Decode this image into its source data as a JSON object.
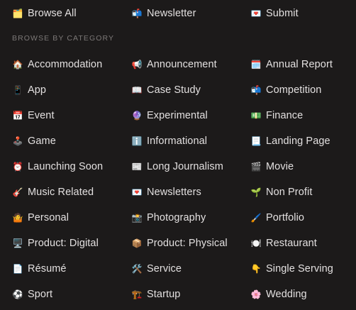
{
  "top": [
    {
      "label": "Browse All",
      "icon": "card-index-dividers-icon",
      "glyph": "🗂️"
    },
    {
      "label": "Newsletter",
      "icon": "mailbox-icon",
      "glyph": "📬"
    },
    {
      "label": "Submit",
      "icon": "love-letter-icon",
      "glyph": "💌"
    }
  ],
  "category_heading": "BROWSE BY CATEGORY",
  "categories": [
    {
      "label": "Accommodation",
      "icon": "house-icon",
      "glyph": "🏠"
    },
    {
      "label": "Announcement",
      "icon": "megaphone-icon",
      "glyph": "📢"
    },
    {
      "label": "Annual Report",
      "icon": "spiral-calendar-icon",
      "glyph": "🗓️"
    },
    {
      "label": "App",
      "icon": "phone-icon",
      "glyph": "📱"
    },
    {
      "label": "Case Study",
      "icon": "open-book-icon",
      "glyph": "📖"
    },
    {
      "label": "Competition",
      "icon": "mailbox-icon",
      "glyph": "📬"
    },
    {
      "label": "Event",
      "icon": "calendar-icon",
      "glyph": "📅"
    },
    {
      "label": "Experimental",
      "icon": "crystal-ball-icon",
      "glyph": "🔮"
    },
    {
      "label": "Finance",
      "icon": "money-icon",
      "glyph": "💵"
    },
    {
      "label": "Game",
      "icon": "joystick-icon",
      "glyph": "🕹️"
    },
    {
      "label": "Informational",
      "icon": "info-icon",
      "glyph": "ℹ️"
    },
    {
      "label": "Landing Page",
      "icon": "page-icon",
      "glyph": "📃"
    },
    {
      "label": "Launching Soon",
      "icon": "alarm-clock-icon",
      "glyph": "⏰"
    },
    {
      "label": "Long Journalism",
      "icon": "newspaper-icon",
      "glyph": "📰"
    },
    {
      "label": "Movie",
      "icon": "clapper-board-icon",
      "glyph": "🎬"
    },
    {
      "label": "Music Related",
      "icon": "guitar-icon",
      "glyph": "🎸"
    },
    {
      "label": "Newsletters",
      "icon": "love-letter-icon",
      "glyph": "💌"
    },
    {
      "label": "Non Profit",
      "icon": "seedling-icon",
      "glyph": "🌱"
    },
    {
      "label": "Personal",
      "icon": "person-icon",
      "glyph": "🤷"
    },
    {
      "label": "Photography",
      "icon": "camera-icon",
      "glyph": "📸"
    },
    {
      "label": "Portfolio",
      "icon": "paintbrush-icon",
      "glyph": "🖌️"
    },
    {
      "label": "Product: Digital",
      "icon": "desktop-computer-icon",
      "glyph": "🖥️"
    },
    {
      "label": "Product: Physical",
      "icon": "package-icon",
      "glyph": "📦"
    },
    {
      "label": "Restaurant",
      "icon": "plate-icon",
      "glyph": "🍽️"
    },
    {
      "label": "Résumé",
      "icon": "document-icon",
      "glyph": "📄"
    },
    {
      "label": "Service",
      "icon": "hammer-wrench-icon",
      "glyph": "🛠️"
    },
    {
      "label": "Single Serving",
      "icon": "pointing-down-icon",
      "glyph": "👇"
    },
    {
      "label": "Sport",
      "icon": "soccer-ball-icon",
      "glyph": "⚽"
    },
    {
      "label": "Startup",
      "icon": "construction-icon",
      "glyph": "🏗️"
    },
    {
      "label": "Wedding",
      "icon": "cherry-blossom-icon",
      "glyph": "🌸"
    }
  ]
}
